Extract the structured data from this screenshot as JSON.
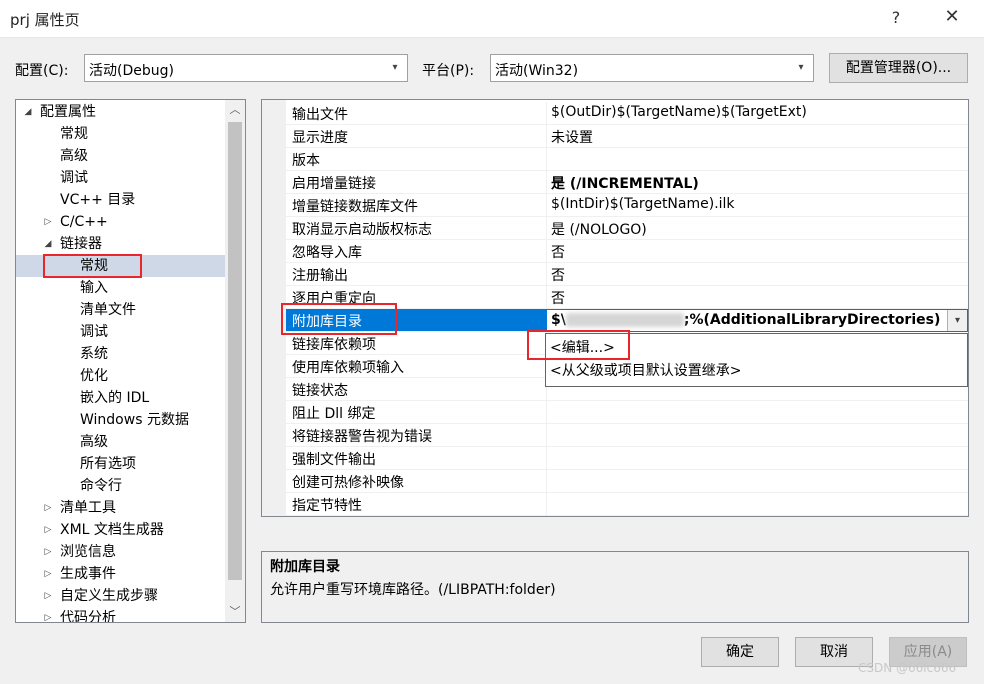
{
  "window": {
    "title": "prj 属性页",
    "help": "?",
    "close": "✕"
  },
  "toolbar": {
    "config_label": "配置(C):",
    "config_value": "活动(Debug)",
    "platform_label": "平台(P):",
    "platform_value": "活动(Win32)",
    "manager_button": "配置管理器(O)..."
  },
  "tree": {
    "items": [
      {
        "label": "配置属性",
        "expander": "◢"
      },
      {
        "label": "常规"
      },
      {
        "label": "高级"
      },
      {
        "label": "调试"
      },
      {
        "label": "VC++ 目录"
      },
      {
        "label": "C/C++",
        "expander": "▷"
      },
      {
        "label": "链接器",
        "expander": "◢"
      },
      {
        "label": "常规"
      },
      {
        "label": "输入"
      },
      {
        "label": "清单文件"
      },
      {
        "label": "调试"
      },
      {
        "label": "系统"
      },
      {
        "label": "优化"
      },
      {
        "label": "嵌入的 IDL"
      },
      {
        "label": "Windows 元数据"
      },
      {
        "label": "高级"
      },
      {
        "label": "所有选项"
      },
      {
        "label": "命令行"
      },
      {
        "label": "清单工具",
        "expander": "▷"
      },
      {
        "label": "XML 文档生成器",
        "expander": "▷"
      },
      {
        "label": "浏览信息",
        "expander": "▷"
      },
      {
        "label": "生成事件",
        "expander": "▷"
      },
      {
        "label": "自定义生成步骤",
        "expander": "▷"
      },
      {
        "label": "代码分析",
        "expander": "▷"
      }
    ]
  },
  "grid": {
    "rows": [
      {
        "name": "输出文件",
        "value": "$(OutDir)$(TargetName)$(TargetExt)"
      },
      {
        "name": "显示进度",
        "value": "未设置"
      },
      {
        "name": "版本",
        "value": ""
      },
      {
        "name": "启用增量链接",
        "value": "是 (/INCREMENTAL)"
      },
      {
        "name": "增量链接数据库文件",
        "value": "$(IntDir)$(TargetName).ilk"
      },
      {
        "name": "取消显示启动版权标志",
        "value": "是 (/NOLOGO)"
      },
      {
        "name": "忽略导入库",
        "value": "否"
      },
      {
        "name": "注册输出",
        "value": "否"
      },
      {
        "name": "逐用户重定向",
        "value": "否"
      },
      {
        "name": "附加库目录",
        "value_prefix": "$\\",
        "value_suffix": ";%(AdditionalLibraryDirectories)"
      },
      {
        "name": "链接库依赖项",
        "value": ""
      },
      {
        "name": "使用库依赖项输入",
        "value": ""
      },
      {
        "name": "链接状态",
        "value": ""
      },
      {
        "name": "阻止 Dll 绑定",
        "value": ""
      },
      {
        "name": "将链接器警告视为错误",
        "value": ""
      },
      {
        "name": "强制文件输出",
        "value": ""
      },
      {
        "name": "创建可热修补映像",
        "value": ""
      },
      {
        "name": "指定节特性",
        "value": ""
      }
    ],
    "dropdown_options": [
      "<编辑...>",
      "<从父级或项目默认设置继承>"
    ]
  },
  "description": {
    "title": "附加库目录",
    "text": "允许用户重写环境库路径。(/LIBPATH:folder)"
  },
  "buttons": {
    "ok": "确定",
    "cancel": "取消",
    "apply": "应用(A)"
  },
  "watermark": "CSDN @66lc666",
  "colors": {
    "selection": "#0078d7",
    "highlight": "#e8262b"
  }
}
